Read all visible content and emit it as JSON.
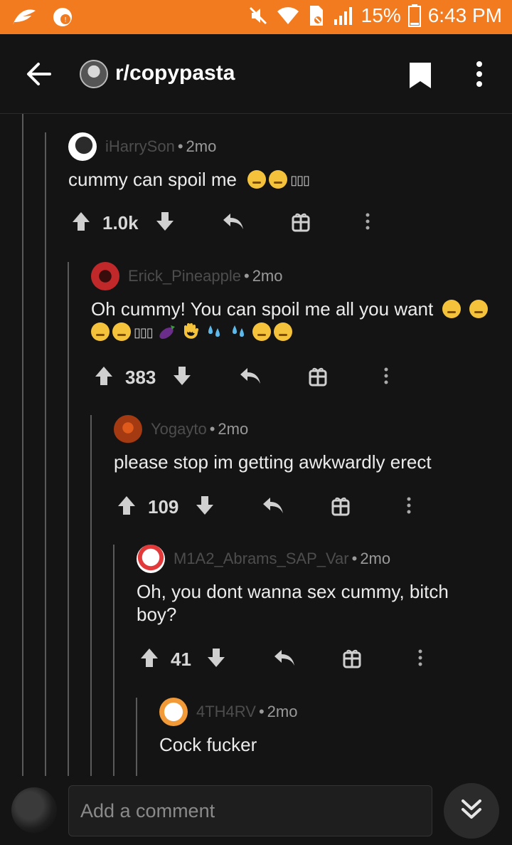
{
  "status_bar": {
    "battery": "15%",
    "time": "6:43 PM"
  },
  "header": {
    "subreddit": "r/copypasta"
  },
  "comments": [
    {
      "author": "iHarrySon",
      "age": "2mo",
      "body": "cummy can spoil me",
      "score": "1.0k",
      "avatar_colors": [
        "#ffffff",
        "#2b2b2b"
      ]
    },
    {
      "author": "Erick_Pineapple",
      "age": "2mo",
      "body": "Oh cummy! You can spoil me all you want",
      "score": "383",
      "avatar_colors": [
        "#c0282a",
        "#3a0d0d"
      ]
    },
    {
      "author": "Yogayto",
      "age": "2mo",
      "body": "please stop im getting awkwardly erect",
      "score": "109",
      "avatar_colors": [
        "#a33a12",
        "#3b1206"
      ]
    },
    {
      "author": "M1A2_Abrams_SAP_Var",
      "age": "2mo",
      "body": "Oh, you dont wanna sex cummy, bitch boy?",
      "score": "41",
      "avatar_colors": [
        "#ffffff",
        "#e23a3a"
      ]
    },
    {
      "author": "4TH4RV",
      "age": "2mo",
      "body": "Cock fucker",
      "score": "",
      "avatar_colors": [
        "#ffffff",
        "#f29a38"
      ]
    }
  ],
  "comment_bar": {
    "placeholder": "Add a comment"
  },
  "colors": {
    "accent": "#f27a1f",
    "background": "#141414"
  },
  "icons": [
    "back-arrow-icon",
    "bookmark-icon",
    "more-vertical-icon",
    "upvote-icon",
    "downvote-icon",
    "reply-icon",
    "gift-icon",
    "double-chevron-down-icon"
  ]
}
